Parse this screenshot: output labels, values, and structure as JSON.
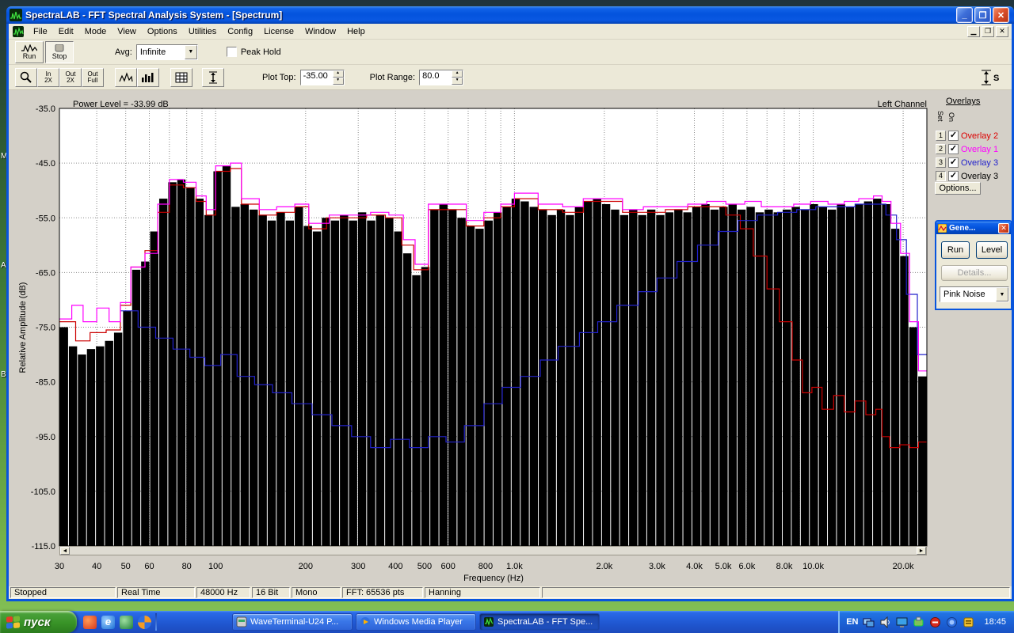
{
  "desktop": {
    "icon_letters": [
      "M",
      "A",
      "B"
    ]
  },
  "window": {
    "title": "SpectraLAB - FFT Spectral Analysis System - [Spectrum]",
    "menu_items": [
      "File",
      "Edit",
      "Mode",
      "View",
      "Options",
      "Utilities",
      "Config",
      "License",
      "Window",
      "Help"
    ],
    "toolbar": {
      "run_label": "Run",
      "stop_label": "Stop",
      "avg_label": "Avg:",
      "avg_value": "Infinite",
      "peak_hold_label": "Peak Hold",
      "zoom_in_line1": "In",
      "zoom_in_line2": "2X",
      "zoom_out_line1": "Out",
      "zoom_out_line2": "2X",
      "zoom_full_line1": "Out",
      "zoom_full_line2": "Full",
      "scale_icon_label": "S",
      "plot_top_label": "Plot Top:",
      "plot_top_value": "-35.00",
      "plot_range_label": "Plot Range:",
      "plot_range_value": "80.0"
    }
  },
  "chart": {
    "power_level": "Power Level = -33.99 dB",
    "channel": "Left Channel",
    "ylabel": "Relative Amplitude (dB)",
    "xlabel": "Frequency (Hz)"
  },
  "chart_data": {
    "type": "bar",
    "title": "FFT Spectrum, Left Channel",
    "xscale": "log",
    "fmin": 30,
    "fmax": 24000,
    "ylim": [
      -115,
      -35
    ],
    "grid": true,
    "y_ticks": [
      "-35.0",
      "-45.0",
      "-55.0",
      "-65.0",
      "-75.0",
      "-85.0",
      "-95.0",
      "-105.0",
      "-115.0"
    ],
    "x_ticks": [
      {
        "f": 30,
        "label": "30"
      },
      {
        "f": 40,
        "label": "40"
      },
      {
        "f": 50,
        "label": "50"
      },
      {
        "f": 60,
        "label": "60"
      },
      {
        "f": 80,
        "label": "80"
      },
      {
        "f": 100,
        "label": "100"
      },
      {
        "f": 200,
        "label": "200"
      },
      {
        "f": 300,
        "label": "300"
      },
      {
        "f": 400,
        "label": "400"
      },
      {
        "f": 500,
        "label": "500"
      },
      {
        "f": 600,
        "label": "600"
      },
      {
        "f": 800,
        "label": "800"
      },
      {
        "f": 1000,
        "label": "1.0k"
      },
      {
        "f": 2000,
        "label": "2.0k"
      },
      {
        "f": 3000,
        "label": "3.0k"
      },
      {
        "f": 4000,
        "label": "4.0k"
      },
      {
        "f": 5000,
        "label": "5.0k"
      },
      {
        "f": 6000,
        "label": "6.0k"
      },
      {
        "f": 8000,
        "label": "8.0k"
      },
      {
        "f": 10000,
        "label": "10.0k"
      },
      {
        "f": 20000,
        "label": "20.0k"
      }
    ],
    "bar_color": "#000000",
    "bars_db": [
      -75,
      -78.5,
      -80,
      -79,
      -78.5,
      -77.5,
      -76,
      -72,
      -64.5,
      -63,
      -57.5,
      -51.5,
      -48.5,
      -48,
      -49.5,
      -51.5,
      -54.5,
      -46.5,
      -45.5,
      -53,
      -52.5,
      -53.5,
      -54.5,
      -55.5,
      -54,
      -55.5,
      -53,
      -56.5,
      -57.5,
      -55,
      -55.5,
      -54.5,
      -55.5,
      -54,
      -55.5,
      -54.5,
      -55,
      -57.5,
      -61.5,
      -65.5,
      -64,
      -53.5,
      -52.5,
      -53.5,
      -55,
      -56.5,
      -57,
      -55.5,
      -54,
      -53,
      -51.5,
      -52,
      -53,
      -53.5,
      -54.5,
      -53.5,
      -54.5,
      -53,
      -52,
      -51.5,
      -52.5,
      -53.5,
      -54.5,
      -53.5,
      -54.5,
      -53.5,
      -54.5,
      -54,
      -53.5,
      -54,
      -53,
      -52.5,
      -53.5,
      -53,
      -52.5,
      -53.5,
      -53,
      -54,
      -53.5,
      -54,
      -53.5,
      -53,
      -53.5,
      -52.5,
      -53,
      -53.5,
      -52.5,
      -53,
      -52.5,
      -52,
      -51.5,
      -52.5,
      -57,
      -62,
      -75,
      -84
    ],
    "overlays": [
      {
        "name": "Overlay 2",
        "color": "#cc0000",
        "points": [
          [
            30,
            -74
          ],
          [
            34,
            -77.5
          ],
          [
            38,
            -76
          ],
          [
            43,
            -75.5
          ],
          [
            48,
            -71
          ],
          [
            52,
            -64
          ],
          [
            58,
            -61
          ],
          [
            64,
            -54
          ],
          [
            70,
            -49
          ],
          [
            78,
            -49.5
          ],
          [
            86,
            -52
          ],
          [
            93,
            -54.5
          ],
          [
            100,
            -46.5
          ],
          [
            112,
            -46
          ],
          [
            122,
            -52.5
          ],
          [
            140,
            -54.5
          ],
          [
            160,
            -54
          ],
          [
            184,
            -53
          ],
          [
            205,
            -57
          ],
          [
            235,
            -55
          ],
          [
            275,
            -55
          ],
          [
            320,
            -54.5
          ],
          [
            370,
            -55
          ],
          [
            420,
            -60
          ],
          [
            460,
            -64.5
          ],
          [
            515,
            -53.5
          ],
          [
            600,
            -53.5
          ],
          [
            690,
            -56.5
          ],
          [
            790,
            -55
          ],
          [
            900,
            -53
          ],
          [
            1000,
            -51.5
          ],
          [
            1200,
            -53.5
          ],
          [
            1450,
            -54
          ],
          [
            1700,
            -52
          ],
          [
            1950,
            -52
          ],
          [
            2300,
            -54
          ],
          [
            2700,
            -54
          ],
          [
            3200,
            -53.5
          ],
          [
            3800,
            -53
          ],
          [
            4400,
            -53
          ],
          [
            5100,
            -54.5
          ],
          [
            5700,
            -57
          ],
          [
            6300,
            -62
          ],
          [
            7000,
            -68
          ],
          [
            7700,
            -74
          ],
          [
            8500,
            -81
          ],
          [
            9200,
            -87
          ],
          [
            9900,
            -86
          ],
          [
            10700,
            -90
          ],
          [
            11700,
            -87.5
          ],
          [
            12700,
            -90.5
          ],
          [
            13800,
            -88.5
          ],
          [
            15000,
            -91
          ],
          [
            16200,
            -90
          ],
          [
            17000,
            -95
          ],
          [
            18000,
            -97
          ],
          [
            19500,
            -96.5
          ],
          [
            21000,
            -97
          ],
          [
            22500,
            -96
          ]
        ]
      },
      {
        "name": "Overlay 3",
        "color": "#2222cc",
        "points": [
          [
            48,
            -72
          ],
          [
            55,
            -75
          ],
          [
            63,
            -77
          ],
          [
            72,
            -79
          ],
          [
            82,
            -80.5
          ],
          [
            92,
            -82
          ],
          [
            104,
            -80
          ],
          [
            118,
            -84
          ],
          [
            135,
            -85.5
          ],
          [
            155,
            -87
          ],
          [
            180,
            -89
          ],
          [
            210,
            -91
          ],
          [
            245,
            -93
          ],
          [
            285,
            -95
          ],
          [
            330,
            -97
          ],
          [
            385,
            -95.5
          ],
          [
            445,
            -97
          ],
          [
            515,
            -95
          ],
          [
            590,
            -96
          ],
          [
            680,
            -93
          ],
          [
            790,
            -89
          ],
          [
            910,
            -86
          ],
          [
            1050,
            -84
          ],
          [
            1220,
            -81
          ],
          [
            1400,
            -78.5
          ],
          [
            1650,
            -76
          ],
          [
            1900,
            -74
          ],
          [
            2200,
            -71
          ],
          [
            2600,
            -68.5
          ],
          [
            3000,
            -66
          ],
          [
            3500,
            -63
          ],
          [
            4100,
            -60
          ],
          [
            4800,
            -57.5
          ],
          [
            5600,
            -55.5
          ],
          [
            6500,
            -54.5
          ],
          [
            7600,
            -54
          ],
          [
            8800,
            -53.5
          ],
          [
            10200,
            -53
          ],
          [
            11900,
            -53
          ],
          [
            13800,
            -52.5
          ],
          [
            16000,
            -52.5
          ],
          [
            17500,
            -54.5
          ],
          [
            19000,
            -59
          ],
          [
            20500,
            -69
          ],
          [
            22300,
            -80
          ]
        ]
      },
      {
        "name": "Overlay 1",
        "color": "#ff00ff",
        "points": [
          [
            30,
            -73.5
          ],
          [
            33,
            -71
          ],
          [
            36,
            -74
          ],
          [
            40,
            -71.5
          ],
          [
            44,
            -74
          ],
          [
            48,
            -70.5
          ],
          [
            52,
            -64
          ],
          [
            58,
            -61.5
          ],
          [
            64,
            -52.5
          ],
          [
            70,
            -48
          ],
          [
            78,
            -48.5
          ],
          [
            86,
            -51
          ],
          [
            93,
            -53.5
          ],
          [
            100,
            -45.5
          ],
          [
            112,
            -45
          ],
          [
            122,
            -51.5
          ],
          [
            140,
            -53.5
          ],
          [
            160,
            -53
          ],
          [
            184,
            -52.5
          ],
          [
            205,
            -56
          ],
          [
            240,
            -54.5
          ],
          [
            280,
            -54.5
          ],
          [
            330,
            -54
          ],
          [
            380,
            -54.5
          ],
          [
            425,
            -59
          ],
          [
            465,
            -63.5
          ],
          [
            515,
            -52.5
          ],
          [
            600,
            -52.5
          ],
          [
            690,
            -55.5
          ],
          [
            790,
            -54
          ],
          [
            900,
            -52.5
          ],
          [
            1000,
            -50.5
          ],
          [
            1200,
            -52.5
          ],
          [
            1450,
            -53
          ],
          [
            1700,
            -51.5
          ],
          [
            1950,
            -51.5
          ],
          [
            2300,
            -53.5
          ],
          [
            2700,
            -53
          ],
          [
            3200,
            -53
          ],
          [
            3800,
            -52.5
          ],
          [
            4400,
            -52
          ],
          [
            5100,
            -52.5
          ],
          [
            5900,
            -52
          ],
          [
            6700,
            -53
          ],
          [
            7600,
            -53
          ],
          [
            8600,
            -52.5
          ],
          [
            9800,
            -52
          ],
          [
            11200,
            -52.5
          ],
          [
            12700,
            -52
          ],
          [
            14200,
            -51.5
          ],
          [
            15900,
            -51
          ],
          [
            17000,
            -52
          ],
          [
            18200,
            -56
          ],
          [
            19600,
            -61.5
          ],
          [
            21000,
            -74
          ],
          [
            22500,
            -83
          ]
        ]
      }
    ]
  },
  "overlays_panel": {
    "title": "Overlays",
    "col_set": "Set",
    "col_on": "On",
    "rows": [
      {
        "num": "1",
        "checked": true,
        "label": "Overlay 2",
        "color": "#dd0000"
      },
      {
        "num": "2",
        "checked": true,
        "label": "Overlay 1",
        "color": "#ff00ff"
      },
      {
        "num": "3",
        "checked": true,
        "label": "Overlay 3",
        "color": "#2222cc"
      },
      {
        "num": "4",
        "checked": true,
        "label": "Overlay 3",
        "color": "#000000"
      }
    ],
    "options_label": "Options..."
  },
  "generator": {
    "title": "Gene...",
    "run_label": "Run",
    "level_label": "Level",
    "details_label": "Details...",
    "signal_value": "Pink Noise"
  },
  "status_bar": [
    "Stopped",
    "Real Time",
    "48000 Hz",
    "16 Bit",
    "Mono",
    "FFT: 65536 pts",
    "Hanning"
  ],
  "taskbar": {
    "start_label": "пуск",
    "buttons": [
      {
        "label": "WaveTerminal-U24 P...",
        "active": false
      },
      {
        "label": "Windows Media Player",
        "active": false
      },
      {
        "label": "SpectraLAB - FFT Spe...",
        "active": true
      }
    ],
    "tray_language": "EN",
    "clock": "18:45"
  }
}
